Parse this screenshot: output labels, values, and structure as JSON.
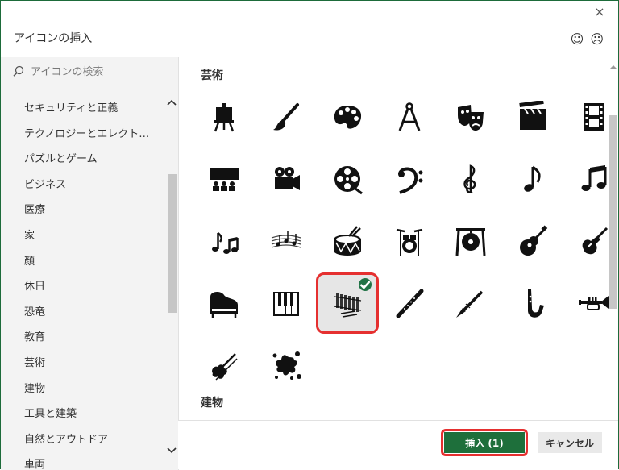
{
  "dialog": {
    "title": "アイコンの挿入",
    "close_label": "×",
    "smile": "☺",
    "frown": "☹"
  },
  "search": {
    "placeholder": "アイコンの検索"
  },
  "categories": [
    "セキュリティと正義",
    "テクノロジーとエレクト…",
    "パズルとゲーム",
    "ビジネス",
    "医療",
    "家",
    "顔",
    "休日",
    "恐竜",
    "教育",
    "芸術",
    "建物",
    "工具と建築",
    "自然とアウトドア",
    "車両"
  ],
  "sections": {
    "art": "芸術",
    "buildings": "建物"
  },
  "icons": [
    "easel-icon",
    "paintbrush-icon",
    "palette-icon",
    "compass-icon",
    "theater-masks-icon",
    "clapperboard-icon",
    "film-strip-icon",
    "cinema-icon",
    "movie-camera-icon",
    "film-reel-icon",
    "bass-clef-icon",
    "treble-clef-icon",
    "eighth-note-icon",
    "beamed-notes-icon",
    "music-notes-icon",
    "sheet-music-icon",
    "drum-icon",
    "drum-kit-icon",
    "gong-icon",
    "acoustic-guitar-icon",
    "electric-guitar-icon",
    "grand-piano-icon",
    "piano-keys-icon",
    "xylophone-icon",
    "flute-icon",
    "clarinet-icon",
    "saxophone-icon",
    "trumpet-icon",
    "violin-icon",
    "paint-splatter-icon"
  ],
  "selected_icon": "xylophone-icon",
  "buttons": {
    "insert": "挿入 (1)",
    "cancel": "キャンセル"
  },
  "colors": {
    "accent": "#1e6f3b",
    "highlight": "#e53030"
  }
}
